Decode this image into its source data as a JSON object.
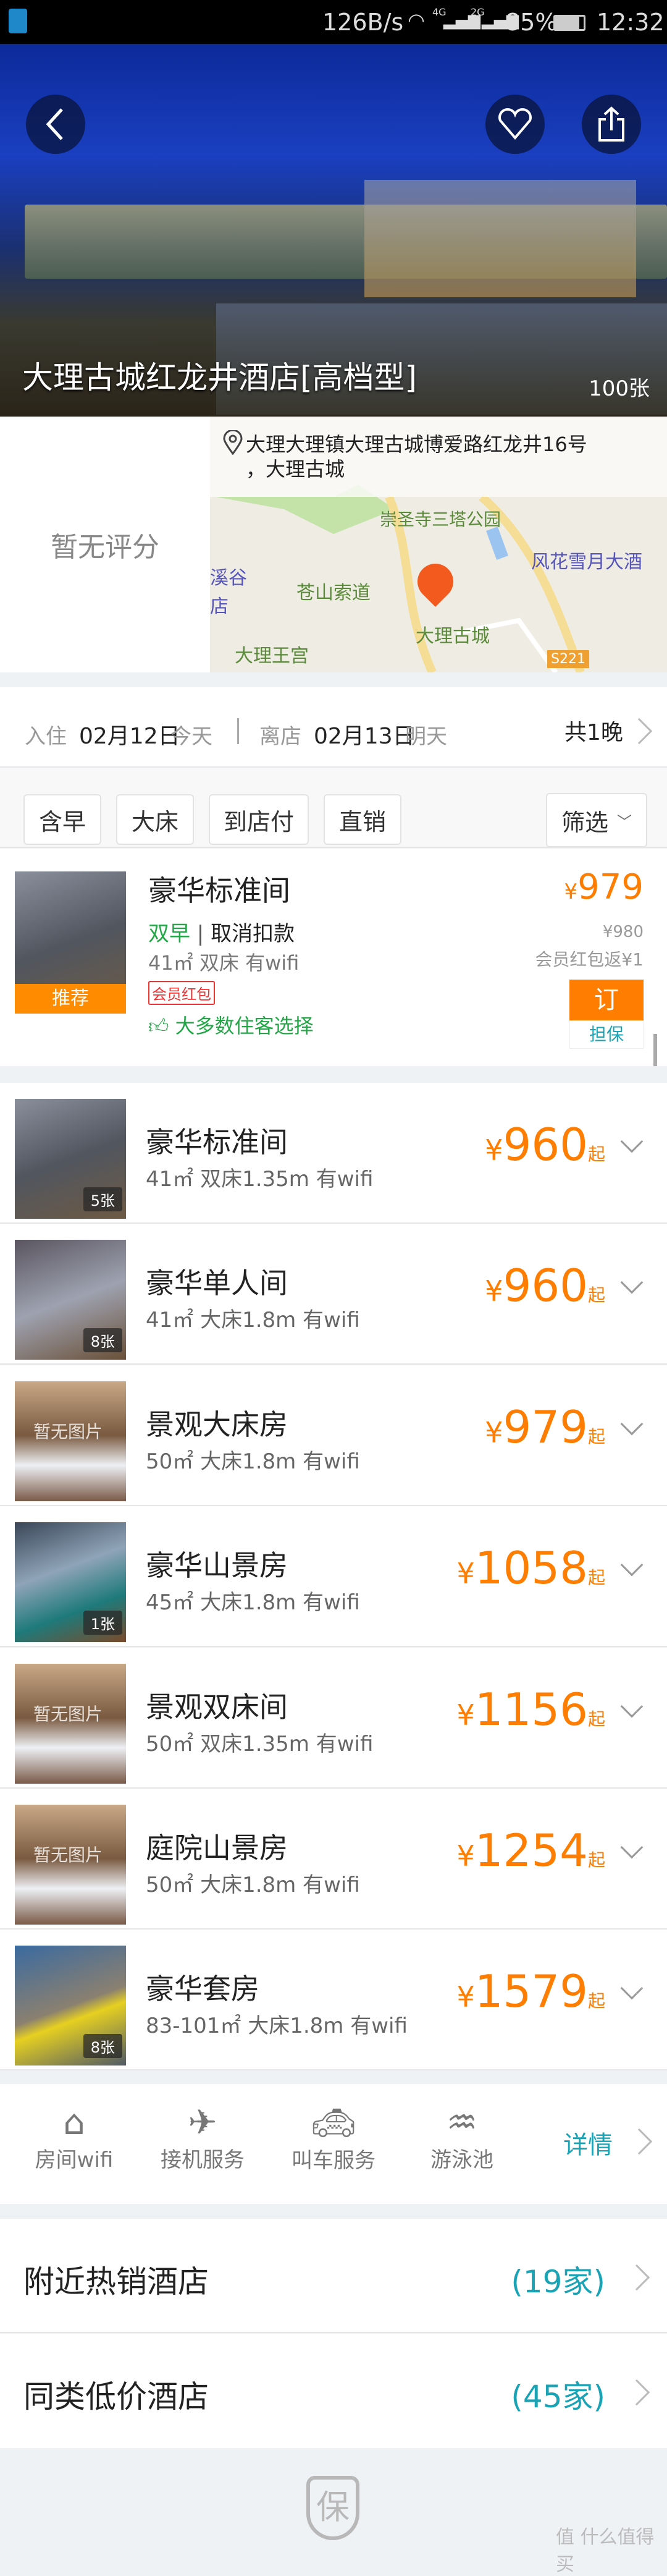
{
  "status_bar": {
    "speed": "126B/s",
    "net1": "4G",
    "net2": "2G",
    "battery": "85%",
    "time": "12:32"
  },
  "hero": {
    "title": "大理古城红龙井酒店[高档型]",
    "photo_count": "100张"
  },
  "rating": {
    "text": "暂无评分"
  },
  "address": {
    "line1": "大理大理镇大理古城博爱路红龙井16号",
    "line2": "，大理古城"
  },
  "map": {
    "labels": [
      "崇圣寺三塔公园",
      "风花雪月大酒",
      "苍山索道",
      "大理古城",
      "大理王宫",
      "溪谷",
      "店"
    ],
    "road": "S221"
  },
  "dates": {
    "checkin_label": "入住",
    "checkin_date": "02月12日",
    "checkin_day": "今天",
    "checkout_label": "离店",
    "checkout_date": "02月13日",
    "checkout_day": "明天",
    "nights": "共1晚"
  },
  "filters": {
    "chips": [
      "含早",
      "大床",
      "到店付",
      "直销"
    ],
    "filter_label": "筛选"
  },
  "featured": {
    "name": "豪华标准间",
    "tag": "推荐",
    "breakfast": "双早",
    "cancel": "取消扣款",
    "spec": "41㎡ 双床 有wifi",
    "coupon": "会员红包",
    "recommend": "大多数住客选择",
    "currency": "¥",
    "price": "979",
    "orig_price": "¥980",
    "rebate": "会员红包返¥1",
    "book": "订",
    "guarantee": "担保"
  },
  "rooms": [
    {
      "name": "豪华标准间",
      "spec": "41㎡ 双床1.35m 有wifi",
      "price": "960",
      "photos": "5张"
    },
    {
      "name": "豪华单人间",
      "spec": "41㎡ 大床1.8m 有wifi",
      "price": "960",
      "photos": "8张"
    },
    {
      "name": "景观大床房",
      "spec": "50㎡ 大床1.8m 有wifi",
      "price": "979",
      "no_image": "暂无图片"
    },
    {
      "name": "豪华山景房",
      "spec": "45㎡ 大床1.8m 有wifi",
      "price": "1058",
      "photos": "1张"
    },
    {
      "name": "景观双床间",
      "spec": "50㎡ 双床1.35m 有wifi",
      "price": "1156",
      "no_image": "暂无图片"
    },
    {
      "name": "庭院山景房",
      "spec": "50㎡ 大床1.8m 有wifi",
      "price": "1254",
      "no_image": "暂无图片"
    },
    {
      "name": "豪华套房",
      "spec": "83-101㎡ 大床1.8m 有wifi",
      "price": "1579",
      "photos": "8张"
    }
  ],
  "price_currency": "¥",
  "price_suffix": "起",
  "amenities": {
    "items": [
      "房间wifi",
      "接机服务",
      "叫车服务",
      "游泳池"
    ],
    "more": "详情"
  },
  "links": [
    {
      "label": "附近热销酒店",
      "count": "(19家)"
    },
    {
      "label": "同类低价酒店",
      "count": "(45家)"
    }
  ],
  "footer": {
    "shield": "保",
    "watermark": "值 什么值得买"
  },
  "colors": {
    "accent": "#ff7d00",
    "teal": "#1aa2b5",
    "green": "#22a646"
  }
}
